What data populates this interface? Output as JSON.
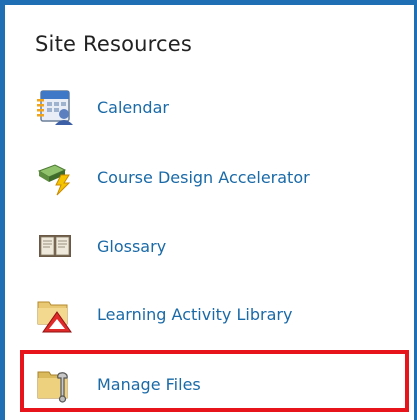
{
  "panel": {
    "title": "Site Resources"
  },
  "items": [
    {
      "label": "Calendar",
      "icon": "calendar-icon"
    },
    {
      "label": "Course Design Accelerator",
      "icon": "course-design-accelerator-icon"
    },
    {
      "label": "Glossary",
      "icon": "glossary-book-icon"
    },
    {
      "label": "Learning Activity Library",
      "icon": "learning-activity-library-icon"
    },
    {
      "label": "Manage Files",
      "icon": "manage-files-folder-icon"
    }
  ],
  "colors": {
    "border": "#1f6fb5",
    "link": "#1a6aa8",
    "highlight": "#e8141c"
  }
}
